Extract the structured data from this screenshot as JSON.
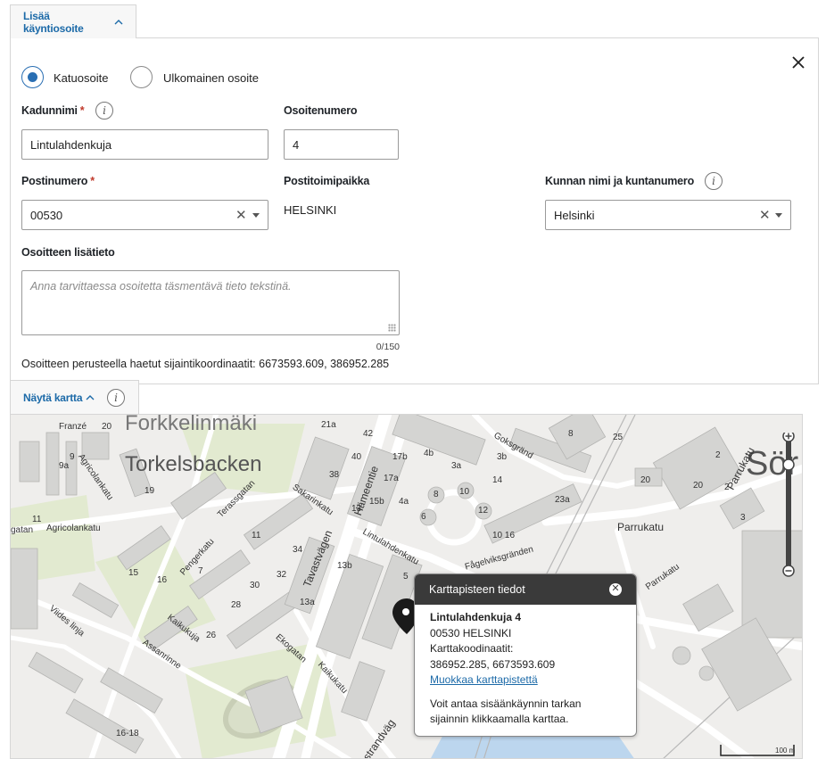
{
  "section": {
    "add_address_tab": "Lisää käyntiosoite",
    "show_map_tab": "Näytä kartta"
  },
  "address_type": {
    "street_label": "Katuosoite",
    "foreign_label": "Ulkomainen osoite",
    "selected": "street"
  },
  "fields": {
    "street_name_label": "Kadunnimi",
    "street_name_value": "Lintulahdenkuja",
    "number_label": "Osoitenumero",
    "number_value": "4",
    "postal_code_label": "Postinumero",
    "postal_code_value": "00530",
    "post_office_label": "Postitoimipaikka",
    "post_office_value": "HELSINKI",
    "municipality_label": "Kunnan nimi ja kuntanumero",
    "municipality_value": "Helsinki",
    "extra_label": "Osoitteen lisätieto",
    "extra_placeholder": "Anna tarvittaessa osoitetta täsmentävä tieto tekstinä.",
    "required_mark": "*",
    "info_glyph": "i",
    "counter": "0/150"
  },
  "coordinates_text": "Osoitteen perusteella haetut sijaintikoordinaatit: 6673593.609, 386952.285",
  "map": {
    "labels": {
      "forkkeli": "Forkkelinmäki",
      "torkelsbacken": "Torkelsbacken",
      "sor": "Sör",
      "parrukatu": "Parrukatu",
      "parrukatu2": "Parrukatu",
      "parrukatu3": "Parrukatu",
      "hameentie": "Hämeentie",
      "tavastvagen": "Tavastvägen",
      "lintulahdenkatu": "Lintulahdenkatu",
      "fagelviksgranden": "Fågelviksgränden",
      "sakarinkatu": "Sakarinkatu",
      "agricolankatu": "Agricolankatu",
      "agricolagatan": "Agricolankatu",
      "gatan": "gatan",
      "pengerkatu": "Pengerkatu",
      "kaikukuja": "Kaikukuja",
      "assanrinne": "Assanrinne",
      "ekogatan": "Ekogatan",
      "kaikukatu": "Kaikukatu",
      "viides_linja": "Viides linja",
      "strandvag": "strandväg",
      "goksgrand": "Goksgränd",
      "terassgatan": "Terassgatan",
      "franzen": "Franzé",
      "scale": "100 m",
      "n20": "20",
      "n21a": "21a",
      "n42": "42",
      "n40": "40",
      "n38": "38",
      "n17a": "17a",
      "n17b": "17b",
      "n4b": "4b",
      "n3a": "3a",
      "n3b": "3b",
      "n14": "14",
      "n8": "8",
      "n10": "10",
      "n12": "12",
      "n6": "6",
      "n4a": "4a",
      "n15b": "15b",
      "n13": "13",
      "n23a": "23a",
      "n1016": "10 16",
      "n25": "25",
      "n20b": "20",
      "n2": "2",
      "n3": "3",
      "n11": "11",
      "n34": "34",
      "n32": "32",
      "n30": "30",
      "n28": "28",
      "n26": "26",
      "n13b": "13b",
      "n13a": "13a",
      "n5": "5",
      "n7": "7",
      "n9": "9",
      "n9a": "9a",
      "n1618": "16-18",
      "n15": "15",
      "n16": "16",
      "n19": "19"
    }
  },
  "popup": {
    "title": "Karttapisteen tiedot",
    "close_glyph": "✕",
    "address_line1": "Lintulahdenkuja 4",
    "address_line2": "00530 HELSINKI",
    "coords_label": "Karttakoodinaatit:",
    "coords_value": "386952.285, 6673593.609",
    "edit_link": "Muokkaa karttapistettä",
    "note": "Voit antaa sisäänkäynnin tarkan sijainnin klikkaamalla karttaa."
  },
  "colors": {
    "accent": "#1c6aa8",
    "radio_selected": "#2a6fb3",
    "required": "#c0392b",
    "popup_header": "#3a3a3a"
  },
  "icons": {
    "close": "close-icon",
    "info": "info-icon",
    "chevron": "chevron-up-icon",
    "clear": "clear-icon",
    "caret": "caret-down-icon",
    "marker": "map-marker-icon",
    "zoom_in": "zoom-in-icon",
    "zoom_out": "zoom-out-icon"
  }
}
